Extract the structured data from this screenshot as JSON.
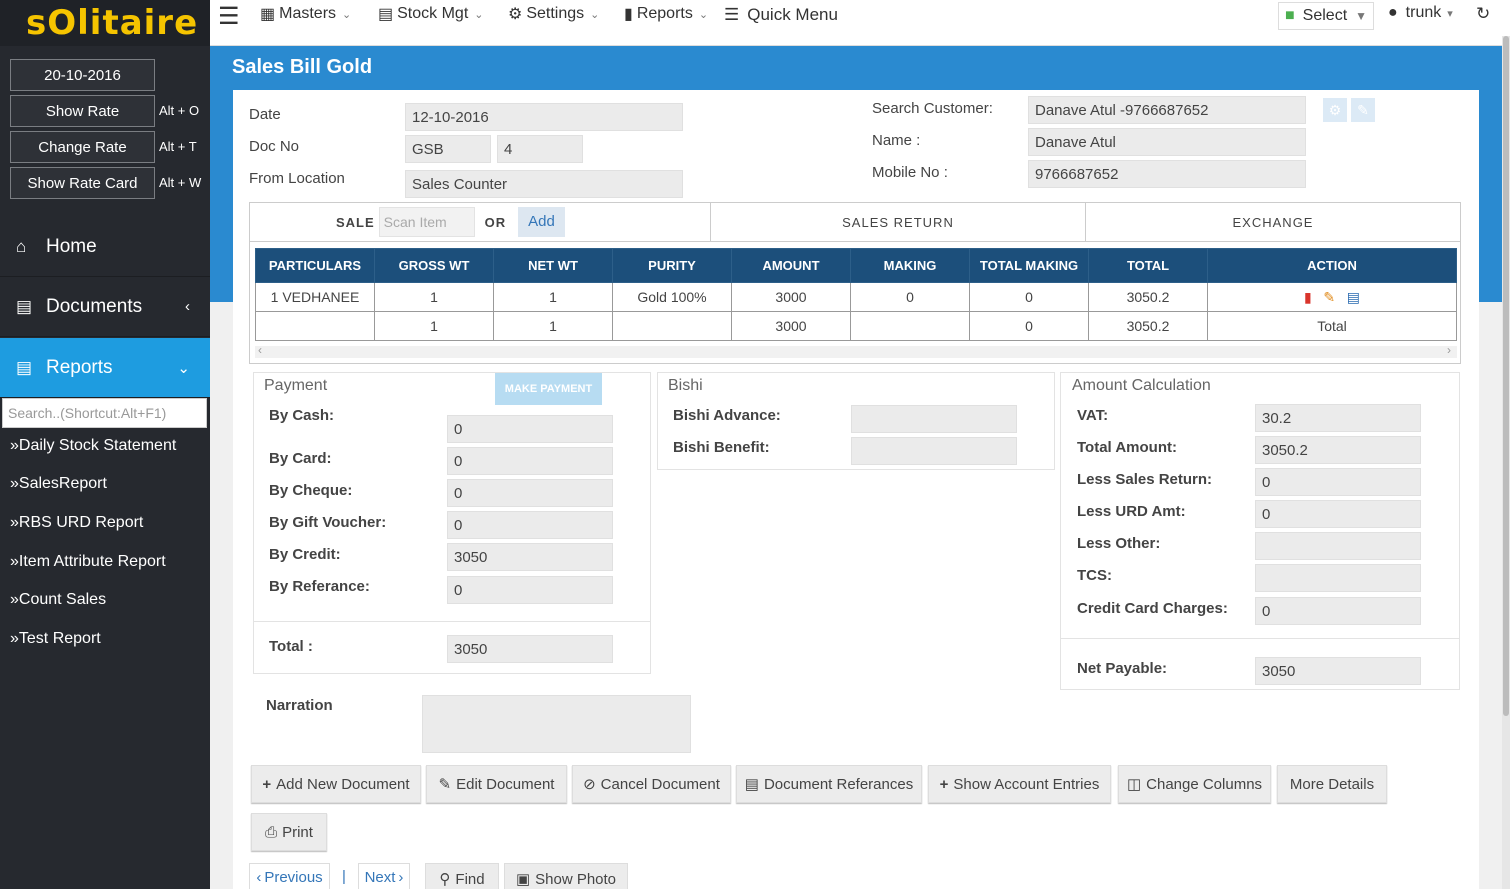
{
  "app": {
    "logo": "sOlitaire"
  },
  "sidebar": {
    "date": "20-10-2016",
    "buttons": [
      {
        "label": "Show Rate",
        "shortcut": "Alt + O"
      },
      {
        "label": "Change Rate",
        "shortcut": "Alt + T"
      },
      {
        "label": "Show Rate Card",
        "shortcut": "Alt + W"
      }
    ],
    "nav": [
      {
        "label": "Home",
        "icon": "home-icon"
      },
      {
        "label": "Documents",
        "icon": "bar-chart-icon"
      },
      {
        "label": "Reports",
        "icon": "bar-chart-icon"
      }
    ],
    "search_placeholder": "Search..(Shortcut:Alt+F1)",
    "reports": [
      "»Daily Stock Statement",
      "»SalesReport",
      "»RBS URD Report",
      "»Item Attribute Report",
      "»Count Sales",
      "»Test Report"
    ]
  },
  "topbar": {
    "menus": [
      "Masters",
      "Stock Mgt",
      "Settings",
      "Reports"
    ],
    "quick_menu": "Quick Menu",
    "select_label": "Select",
    "user": "trunk"
  },
  "page": {
    "title": "Sales Bill Gold"
  },
  "header": {
    "date_label": "Date",
    "date_value": "12-10-2016",
    "docno_label": "Doc No",
    "docno_prefix": "GSB",
    "docno_value": "4",
    "location_label": "From Location",
    "location_value": "Sales Counter",
    "search_label": "Search Customer:",
    "search_value": "Danave Atul -9766687652",
    "name_label": "Name :",
    "name_value": "Danave Atul",
    "mobile_label": "Mobile No :",
    "mobile_value": "9766687652"
  },
  "tabs": {
    "sale": "SALE",
    "scan_placeholder": "Scan Item",
    "or": "OR",
    "add": "Add",
    "sales_return": "SALES RETURN",
    "exchange": "EXCHANGE"
  },
  "grid": {
    "columns": [
      "PARTICULARS",
      "GROSS WT",
      "NET WT",
      "PURITY",
      "AMOUNT",
      "MAKING",
      "TOTAL MAKING",
      "TOTAL",
      "ACTION"
    ],
    "rows": [
      [
        "1 VEDHANEE",
        "1",
        "1",
        "Gold 100%",
        "3000",
        "0",
        "0",
        "3050.2",
        ""
      ]
    ],
    "total_row": [
      "",
      "1",
      "1",
      "",
      "3000",
      "",
      "0",
      "3050.2",
      "Total"
    ]
  },
  "payment": {
    "title": "Payment",
    "make_payment": "MAKE PAYMENT",
    "fields": [
      {
        "label": "By Cash:",
        "value": "0"
      },
      {
        "label": "By Card:",
        "value": "0"
      },
      {
        "label": "By Cheque:",
        "value": "0"
      },
      {
        "label": "By Gift Voucher:",
        "value": "0"
      },
      {
        "label": "By Credit:",
        "value": "3050"
      },
      {
        "label": "By Referance:",
        "value": "0"
      }
    ],
    "total_label": "Total :",
    "total_value": "3050"
  },
  "bishi": {
    "title": "Bishi",
    "advance_label": "Bishi Advance:",
    "advance_value": "",
    "benefit_label": "Bishi Benefit:",
    "benefit_value": ""
  },
  "amount": {
    "title": "Amount Calculation",
    "fields": [
      {
        "label": "VAT:",
        "value": "30.2"
      },
      {
        "label": "Total Amount:",
        "value": "3050.2"
      },
      {
        "label": "Less Sales Return:",
        "value": "0"
      },
      {
        "label": "Less URD Amt:",
        "value": "0"
      },
      {
        "label": "Less Other:",
        "value": ""
      },
      {
        "label": "TCS:",
        "value": ""
      },
      {
        "label": "Credit Card Charges:",
        "value": "0"
      }
    ],
    "net_label": "Net Payable:",
    "net_value": "3050"
  },
  "narration": {
    "label": "Narration",
    "value": ""
  },
  "actions": {
    "add_new": "Add New Document",
    "edit": "Edit Document",
    "cancel": "Cancel Document",
    "refs": "Document Referances",
    "account": "Show Account Entries",
    "columns": "Change Columns",
    "more": "More Details",
    "print": "Print"
  },
  "pager": {
    "previous": "Previous",
    "next": "Next",
    "find": "Find",
    "photo": "Show Photo"
  }
}
